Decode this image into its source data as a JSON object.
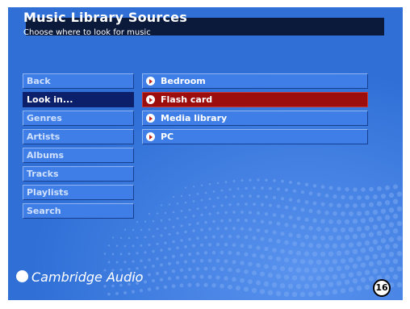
{
  "header": {
    "title": "Music Library Sources",
    "subtitle": "Choose where to look for music"
  },
  "menu": {
    "items": [
      {
        "label": "Back"
      },
      {
        "label": "Look in..."
      },
      {
        "label": "Genres"
      },
      {
        "label": "Artists"
      },
      {
        "label": "Albums"
      },
      {
        "label": "Tracks"
      },
      {
        "label": "Playlists"
      },
      {
        "label": "Search"
      }
    ],
    "selected": "Look in..."
  },
  "sources": {
    "items": [
      {
        "label": "Bedroom",
        "icon": "play-icon"
      },
      {
        "label": "Flash card",
        "icon": "play-icon"
      },
      {
        "label": "Media library",
        "icon": "play-icon"
      },
      {
        "label": "PC",
        "icon": "play-icon"
      }
    ],
    "selected": "Flash card"
  },
  "brand": {
    "name": "Cambridge Audio"
  },
  "page": {
    "number": "16"
  },
  "colors": {
    "background": "#2f6fd6",
    "title_bar": "#0b1a3a",
    "menu_selected": "#0b1f6b",
    "source_selected": "#9c0d0d"
  }
}
